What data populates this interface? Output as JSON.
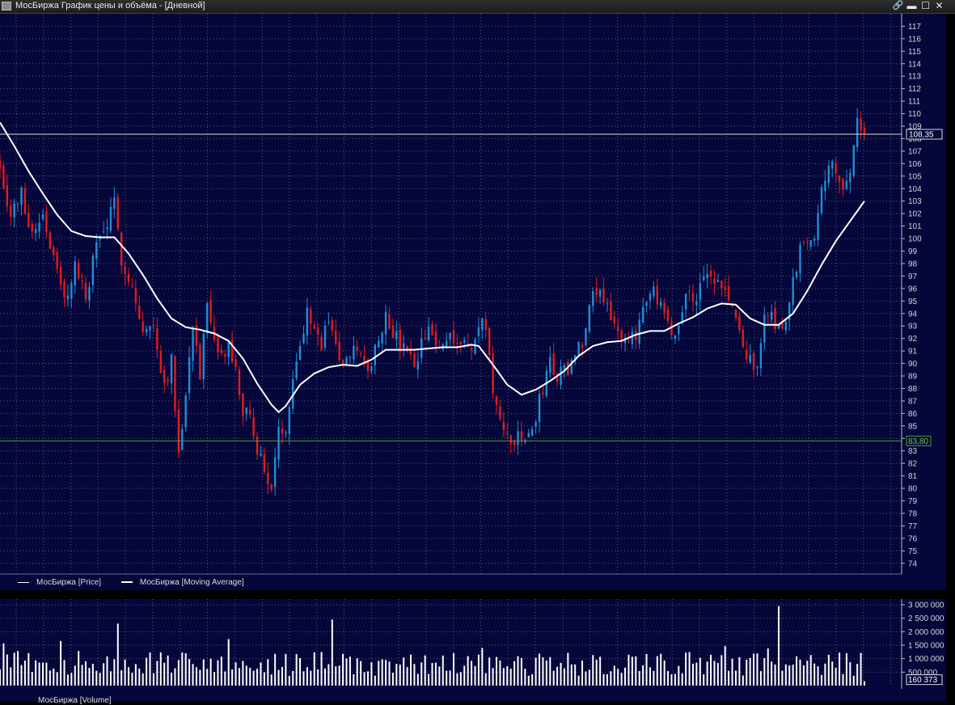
{
  "window": {
    "title": "МосБиржа График цены и объёма - [Дневной]",
    "buttons": {
      "link": "🔗",
      "minimize": "▬",
      "maximize": "☐",
      "close": "✕"
    }
  },
  "legend": {
    "price": "МосБиржа [Price]",
    "ma": "МосБиржа [Moving Average]",
    "volume": "МосБиржа [Volume]"
  },
  "colors": {
    "background": "#05063a",
    "up": "#1e8fd6",
    "down": "#e41b1b",
    "ma": "#ffffff",
    "grid": "#5a5e7e",
    "support": "#4fa02c",
    "volume": "#ffffff"
  },
  "chart_data": [
    {
      "type": "candlestick",
      "panel": "price",
      "title": "",
      "ylim": [
        74,
        117
      ],
      "yticks": [
        74,
        75,
        76,
        77,
        78,
        79,
        80,
        81,
        82,
        83,
        84,
        85,
        86,
        87,
        88,
        89,
        90,
        91,
        92,
        93,
        94,
        95,
        96,
        97,
        98,
        99,
        100,
        101,
        102,
        103,
        104,
        105,
        106,
        107,
        108,
        109,
        110,
        111,
        112,
        113,
        114,
        115,
        116,
        117
      ],
      "grid": true,
      "legend_position": "bottom-left",
      "current_price": "108,35",
      "current_price_value": 108.35,
      "support_level": "83,80",
      "support_level_value": 83.8,
      "price_path": [
        [
          0,
          106
        ],
        [
          3,
          101.8
        ],
        [
          6,
          103.6
        ],
        [
          9,
          100.4
        ],
        [
          12,
          102.1
        ],
        [
          15,
          98.4
        ],
        [
          18,
          94.9
        ],
        [
          21,
          97.8
        ],
        [
          24,
          95.2
        ],
        [
          27,
          99.6
        ],
        [
          30,
          101.2
        ],
        [
          32,
          102.6
        ],
        [
          34,
          98.5
        ],
        [
          37,
          96.2
        ],
        [
          40,
          92.4
        ],
        [
          43,
          92.9
        ],
        [
          46,
          88.4
        ],
        [
          48,
          90.1
        ],
        [
          50,
          83.3
        ],
        [
          52,
          87.4
        ],
        [
          54,
          93.4
        ],
        [
          56,
          89.2
        ],
        [
          58,
          94.4
        ],
        [
          60,
          91.2
        ],
        [
          62,
          90.5
        ],
        [
          64,
          91.3
        ],
        [
          66,
          89.2
        ],
        [
          68,
          86.2
        ],
        [
          70,
          85.4
        ],
        [
          72,
          83.4
        ],
        [
          74,
          81.2
        ],
        [
          76,
          80.2
        ],
        [
          78,
          84.3
        ],
        [
          80,
          84.9
        ],
        [
          82,
          89.4
        ],
        [
          84,
          91.2
        ],
        [
          86,
          94.6
        ],
        [
          88,
          93.1
        ],
        [
          90,
          91.2
        ],
        [
          92,
          93.8
        ],
        [
          94,
          91.5
        ],
        [
          96,
          89.8
        ],
        [
          98,
          90.2
        ],
        [
          100,
          91.4
        ],
        [
          102,
          89.8
        ],
        [
          104,
          90.1
        ],
        [
          106,
          92.4
        ],
        [
          108,
          93.8
        ],
        [
          110,
          92.6
        ],
        [
          112,
          91.2
        ],
        [
          114,
          91.1
        ],
        [
          116,
          89.2
        ],
        [
          118,
          91.4
        ],
        [
          120,
          92.8
        ],
        [
          122,
          91.2
        ],
        [
          124,
          91.6
        ],
        [
          126,
          92.6
        ],
        [
          128,
          91.8
        ],
        [
          130,
          91.6
        ],
        [
          132,
          90.9
        ],
        [
          134,
          92.8
        ],
        [
          136,
          93.2
        ],
        [
          138,
          87.8
        ],
        [
          140,
          84.9
        ],
        [
          142,
          84.3
        ],
        [
          144,
          83.9
        ],
        [
          146,
          83.9
        ],
        [
          148,
          84.2
        ],
        [
          150,
          85.6
        ],
        [
          152,
          88.2
        ],
        [
          154,
          90.2
        ],
        [
          156,
          88.9
        ],
        [
          158,
          89.4
        ],
        [
          160,
          90.1
        ],
        [
          162,
          91.2
        ],
        [
          164,
          92.6
        ],
        [
          166,
          96.4
        ],
        [
          168,
          95.8
        ],
        [
          170,
          94.8
        ],
        [
          172,
          93.4
        ],
        [
          174,
          91.3
        ],
        [
          176,
          91.5
        ],
        [
          178,
          92.2
        ],
        [
          180,
          94.8
        ],
        [
          182,
          96.2
        ],
        [
          184,
          94.9
        ],
        [
          186,
          93.8
        ],
        [
          188,
          91.8
        ],
        [
          190,
          93.1
        ],
        [
          192,
          95.6
        ],
        [
          194,
          95.2
        ],
        [
          196,
          96.1
        ],
        [
          198,
          96.8
        ],
        [
          200,
          96.6
        ],
        [
          202,
          95.9
        ],
        [
          204,
          95.4
        ],
        [
          206,
          93.4
        ],
        [
          208,
          91.2
        ],
        [
          210,
          90.1
        ],
        [
          212,
          90.2
        ],
        [
          214,
          93.4
        ],
        [
          216,
          94.1
        ],
        [
          218,
          92.8
        ],
        [
          220,
          93.2
        ],
        [
          222,
          96.4
        ],
        [
          224,
          99.2
        ],
        [
          226,
          100.1
        ],
        [
          228,
          100.4
        ],
        [
          230,
          104.4
        ],
        [
          232,
          106.1
        ],
        [
          234,
          104.9
        ],
        [
          236,
          104.6
        ],
        [
          238,
          105.1
        ],
        [
          240,
          109.2
        ],
        [
          242,
          108.4
        ]
      ],
      "moving_average": [
        [
          0,
          109.3
        ],
        [
          4,
          107.4
        ],
        [
          8,
          105.4
        ],
        [
          12,
          103.6
        ],
        [
          16,
          101.9
        ],
        [
          20,
          100.6
        ],
        [
          24,
          100.2
        ],
        [
          28,
          100.1
        ],
        [
          32,
          100.1
        ],
        [
          36,
          98.8
        ],
        [
          40,
          97.1
        ],
        [
          44,
          95.2
        ],
        [
          48,
          93.6
        ],
        [
          52,
          92.9
        ],
        [
          56,
          92.7
        ],
        [
          60,
          92.4
        ],
        [
          64,
          91.8
        ],
        [
          68,
          90.4
        ],
        [
          72,
          88.4
        ],
        [
          76,
          86.7
        ],
        [
          78,
          86.1
        ],
        [
          80,
          86.6
        ],
        [
          84,
          88.3
        ],
        [
          88,
          89.2
        ],
        [
          92,
          89.7
        ],
        [
          96,
          89.9
        ],
        [
          100,
          89.8
        ],
        [
          104,
          90.3
        ],
        [
          108,
          91.1
        ],
        [
          112,
          91.1
        ],
        [
          116,
          91.1
        ],
        [
          120,
          91.2
        ],
        [
          124,
          91.3
        ],
        [
          128,
          91.3
        ],
        [
          132,
          91.5
        ],
        [
          134,
          91.4
        ],
        [
          138,
          89.9
        ],
        [
          142,
          88.3
        ],
        [
          146,
          87.5
        ],
        [
          150,
          87.9
        ],
        [
          154,
          88.6
        ],
        [
          158,
          89.4
        ],
        [
          162,
          90.6
        ],
        [
          166,
          91.4
        ],
        [
          170,
          91.7
        ],
        [
          174,
          91.8
        ],
        [
          178,
          92.3
        ],
        [
          182,
          92.6
        ],
        [
          186,
          92.6
        ],
        [
          190,
          93.2
        ],
        [
          194,
          93.7
        ],
        [
          198,
          94.4
        ],
        [
          202,
          94.8
        ],
        [
          206,
          94.7
        ],
        [
          210,
          93.6
        ],
        [
          214,
          93.1
        ],
        [
          218,
          93.1
        ],
        [
          222,
          94.0
        ],
        [
          226,
          95.8
        ],
        [
          230,
          97.9
        ],
        [
          234,
          99.8
        ],
        [
          238,
          101.4
        ],
        [
          242,
          103
        ]
      ]
    },
    {
      "type": "bar",
      "panel": "volume",
      "title": "",
      "ylim": [
        0,
        3000000
      ],
      "yticks": [
        "500 000",
        "1 000 000",
        "1 500 000",
        "2 000 000",
        "2 500 000",
        "3 000 000"
      ],
      "last_volume": "160 373",
      "spikes": [
        [
          33,
          2300000
        ],
        [
          93,
          2450000
        ],
        [
          218,
          2950000
        ]
      ]
    }
  ]
}
